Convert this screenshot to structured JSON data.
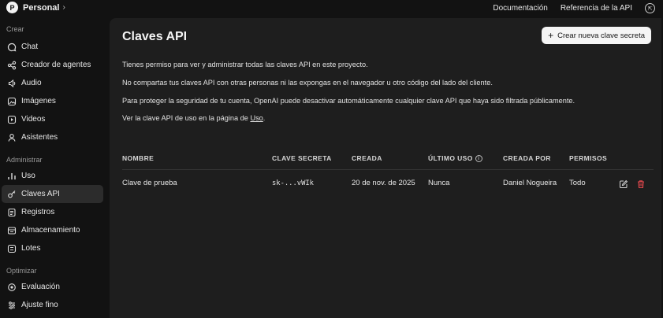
{
  "org": {
    "initial": "P",
    "name": "Personal"
  },
  "top_links": {
    "docs": "Documentación",
    "api_ref": "Referencia de la API"
  },
  "sidebar": {
    "sections": [
      {
        "title": "Crear",
        "items": [
          {
            "label": "Chat",
            "icon": "chat-icon"
          },
          {
            "label": "Creador de agentes",
            "icon": "agent-builder-icon"
          },
          {
            "label": "Audio",
            "icon": "audio-icon"
          },
          {
            "label": "Imágenes",
            "icon": "image-icon"
          },
          {
            "label": "Videos",
            "icon": "video-icon"
          },
          {
            "label": "Asistentes",
            "icon": "assistants-icon"
          }
        ]
      },
      {
        "title": "Administrar",
        "items": [
          {
            "label": "Uso",
            "icon": "usage-icon"
          },
          {
            "label": "Claves API",
            "icon": "key-icon",
            "active": true
          },
          {
            "label": "Registros",
            "icon": "logs-icon"
          },
          {
            "label": "Almacenamiento",
            "icon": "storage-icon"
          },
          {
            "label": "Lotes",
            "icon": "batches-icon"
          }
        ]
      },
      {
        "title": "Optimizar",
        "items": [
          {
            "label": "Evaluación",
            "icon": "evaluation-icon"
          },
          {
            "label": "Ajuste fino",
            "icon": "fine-tune-icon"
          }
        ]
      }
    ]
  },
  "main": {
    "title": "Claves API",
    "create_button": "Crear nueva clave secreta",
    "paragraphs": [
      "Tienes permiso para ver y administrar todas las claves API en este proyecto.",
      "No compartas tus claves API con otras personas ni las expongas en el navegador u otro código del lado del cliente.",
      "Para proteger la seguridad de tu cuenta, OpenAI puede desactivar automáticamente cualquier clave API que haya sido filtrada públicamente."
    ],
    "usage_note": {
      "prefix": "Ver la clave API de uso en la página de ",
      "link": "Uso",
      "suffix": "."
    },
    "table": {
      "headers": {
        "name": "NOMBRE",
        "secret": "CLAVE SECRETA",
        "created": "CREADA",
        "last_used": "ÚLTIMO USO",
        "created_by": "CREADA POR",
        "permissions": "PERMISOS"
      },
      "rows": [
        {
          "name": "Clave de prueba",
          "secret": "sk-...vWIk",
          "created": "20 de nov. de 2025",
          "last_used": "Nunca",
          "created_by": "Daniel Nogueira",
          "permissions": "Todo"
        }
      ]
    }
  },
  "colors": {
    "delete_icon": "#e5484d",
    "background": "#121212",
    "panel": "#1e1e1e"
  }
}
